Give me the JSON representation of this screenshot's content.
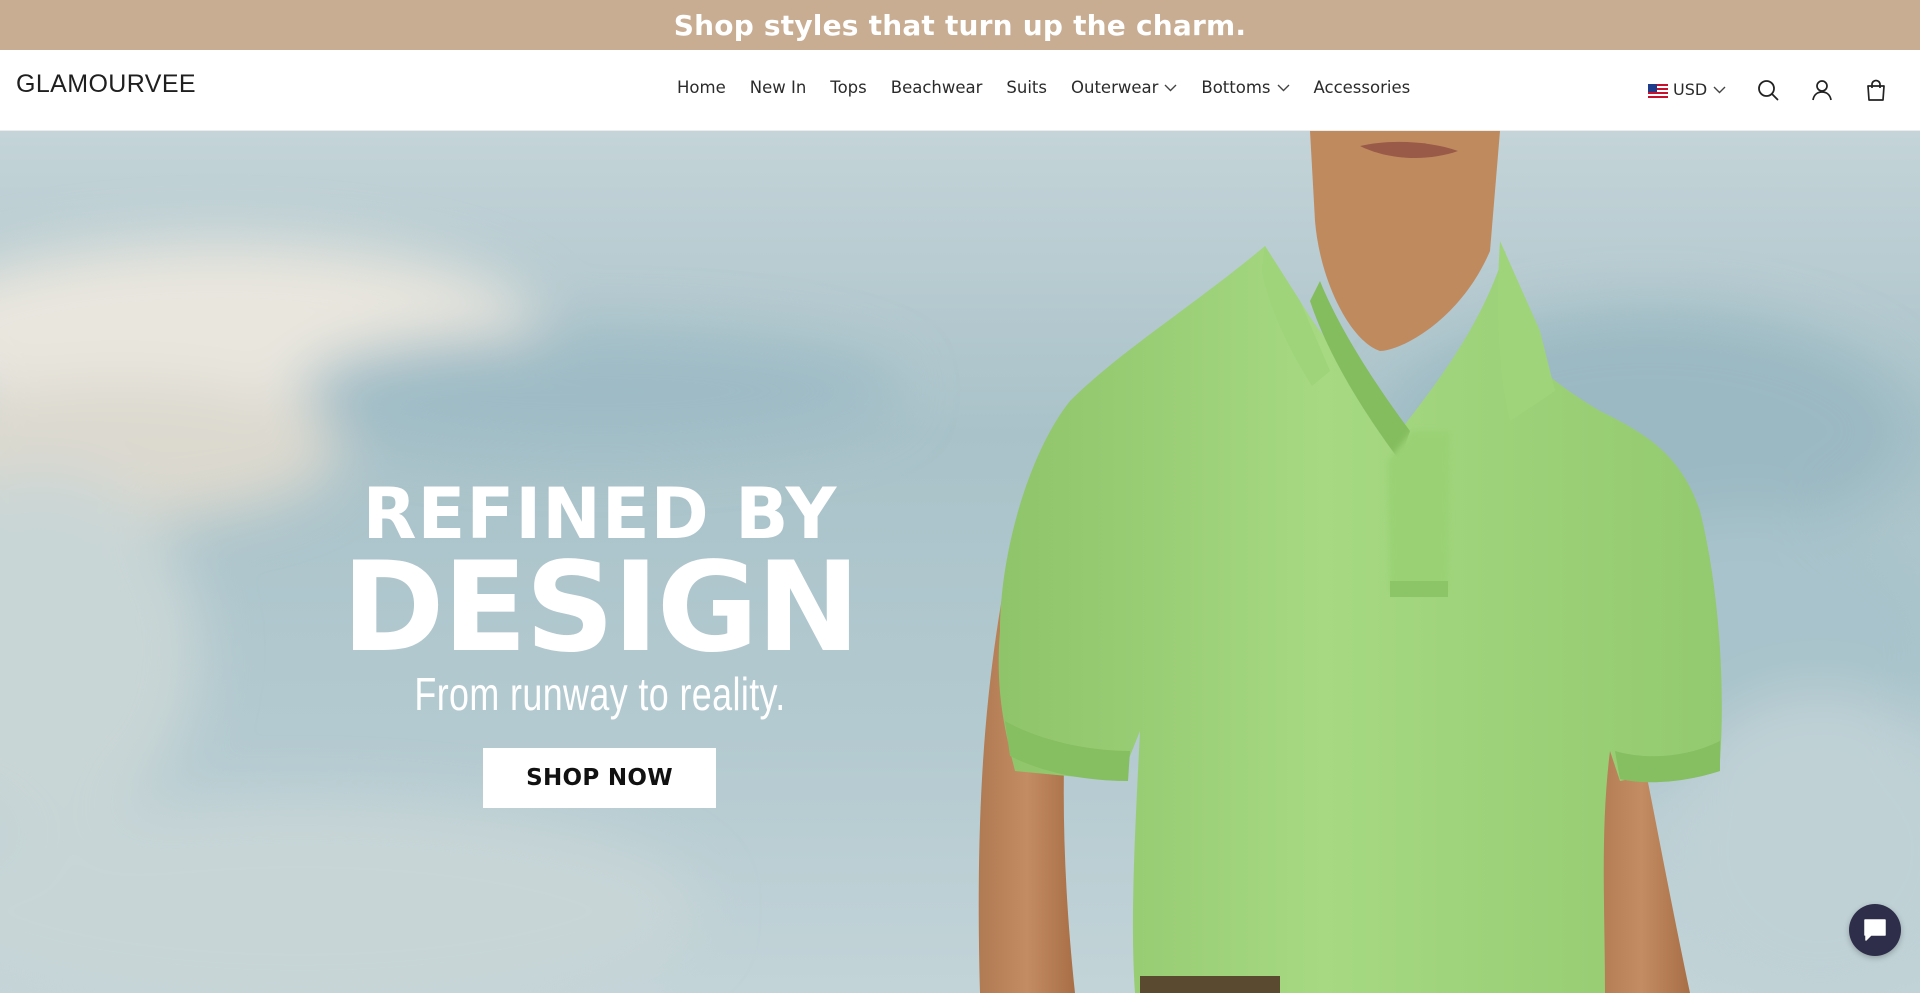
{
  "announcement": {
    "text": "Shop styles that turn up the charm."
  },
  "header": {
    "logo": "GLAMOURVEE",
    "nav": [
      {
        "label": "Home",
        "has_dropdown": false
      },
      {
        "label": "New In",
        "has_dropdown": false
      },
      {
        "label": "Tops",
        "has_dropdown": false
      },
      {
        "label": "Beachwear",
        "has_dropdown": false
      },
      {
        "label": "Suits",
        "has_dropdown": false
      },
      {
        "label": "Outerwear",
        "has_dropdown": true
      },
      {
        "label": "Bottoms",
        "has_dropdown": true
      },
      {
        "label": "Accessories",
        "has_dropdown": false
      }
    ],
    "currency": {
      "code": "USD",
      "flag": "us-flag-icon"
    },
    "icons": [
      "search-icon",
      "account-icon",
      "cart-icon"
    ]
  },
  "hero": {
    "line1": "REFINED BY",
    "line2": "DESIGN",
    "line3": "From runway to reality.",
    "cta": "SHOP NOW"
  },
  "chat": {
    "icon": "chat-icon"
  },
  "colors": {
    "announcement_bg": "#c8ad92",
    "shirt": "#9fd47a",
    "chat_bg": "#2e2e4a"
  }
}
